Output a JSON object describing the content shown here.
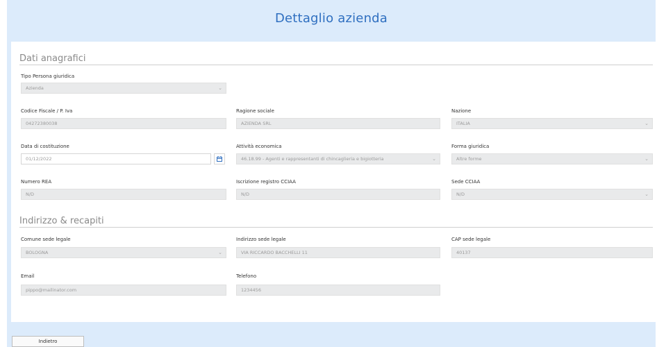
{
  "header": {
    "title": "Dettaglio azienda"
  },
  "sections": {
    "anagrafici": "Dati anagrafici",
    "indirizzo": "Indirizzo & recapiti"
  },
  "fields": {
    "tipo_persona": {
      "label": "Tipo Persona giuridica",
      "value": "Azienda"
    },
    "codice_fiscale": {
      "label": "Codice Fiscale / P. Iva",
      "value": "04272380038"
    },
    "ragione_sociale": {
      "label": "Ragione sociale",
      "value": "AZIENDA SRL"
    },
    "nazione": {
      "label": "Nazione",
      "value": "ITALIA"
    },
    "data_costituzione": {
      "label": "Data di costituzione",
      "value": "01/12/2022"
    },
    "attivita_economica": {
      "label": "Attività economica",
      "value": "46.18.99 - Agenti e rappresentanti di chincaglieria e bigiotteria"
    },
    "forma_giuridica": {
      "label": "Forma giuridica",
      "value": "Altre forme"
    },
    "numero_rea": {
      "label": "Numero REA",
      "value": "N/D"
    },
    "iscrizione_cciaa": {
      "label": "Iscrizione registro CCIAA",
      "value": "N/D"
    },
    "sede_cciaa": {
      "label": "Sede CCIAA",
      "value": "N/D"
    },
    "comune_sede": {
      "label": "Comune sede legale",
      "value": "BOLOGNA"
    },
    "indirizzo_sede": {
      "label": "Indirizzo sede legale",
      "value": "VIA RICCARDO BACCHELLI 11"
    },
    "cap_sede": {
      "label": "CAP sede legale",
      "value": "40137"
    },
    "email": {
      "label": "Email",
      "value": "pippo@mailinator.com"
    },
    "telefono": {
      "label": "Telefono",
      "value": "1234456"
    }
  },
  "footer": {
    "back_label": "Indietro"
  },
  "colors": {
    "title": "#2f6fc0",
    "frame": "#dcebfb",
    "field": "#e9eaeb"
  },
  "icons": {
    "select": "chevron-down-icon",
    "date": "calendar-icon"
  }
}
